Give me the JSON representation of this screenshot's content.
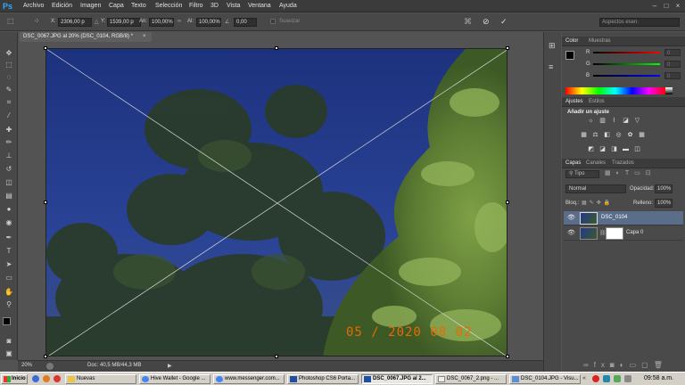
{
  "app": {
    "logo": "Ps"
  },
  "menu": [
    "Archivo",
    "Edición",
    "Imagen",
    "Capa",
    "Texto",
    "Selección",
    "Filtro",
    "3D",
    "Vista",
    "Ventana",
    "Ayuda"
  ],
  "options": {
    "x_label": "X:",
    "x_value": "2306,00 p",
    "y_label": "Y:",
    "y_value": "1539,00 p",
    "w_label": "An:",
    "w_value": "100,00%",
    "h_label": "Al:",
    "h_value": "100,00%",
    "angle_value": "0,00",
    "smooth_label": "Suavizar",
    "workspace": "Aspectos esen."
  },
  "document": {
    "tab_title": "DSC_0067.JPG al 20% (DSC_0104, RGB/8) *",
    "close": "×",
    "date_stamp": "05 / 2020 08 02",
    "zoom": "20%",
    "doc_info": "Doc: 40,5 MB/44,3 MB"
  },
  "color_panel": {
    "tabs": [
      "Color",
      "Muestras"
    ],
    "labels": [
      "R",
      "G",
      "B"
    ],
    "values": [
      "0",
      "0",
      "0"
    ]
  },
  "adjustments_panel": {
    "tabs": [
      "Ajustes",
      "Estilos"
    ],
    "heading": "Añadir un ajuste"
  },
  "layers_panel": {
    "tabs": [
      "Capas",
      "Canales",
      "Trazados"
    ],
    "filter": "Tipo",
    "blend_mode": "Normal",
    "opacity_label": "Opacidad:",
    "opacity_value": "100%",
    "lock_label": "Bloq.:",
    "fill_label": "Relleno:",
    "fill_value": "100%",
    "layers": [
      {
        "name": "DSC_0104",
        "selected": true
      },
      {
        "name": "Capa 0",
        "selected": false
      }
    ]
  },
  "taskbar": {
    "start": "Inicio",
    "items": [
      "Nuevas",
      "Hive Wallet - Google ...",
      "www.messenger.com...",
      "Photoshop CS6 Porta...",
      "DSC_0067.JPG al 2...",
      "DSC_0067_2.png - ...",
      "DSC_0104.JPG - Visu..."
    ],
    "active_index": 4,
    "clock": "09:58 a.m."
  },
  "colors": {
    "accent": "#31a8ff",
    "selected_layer": "#5a6e8a"
  }
}
